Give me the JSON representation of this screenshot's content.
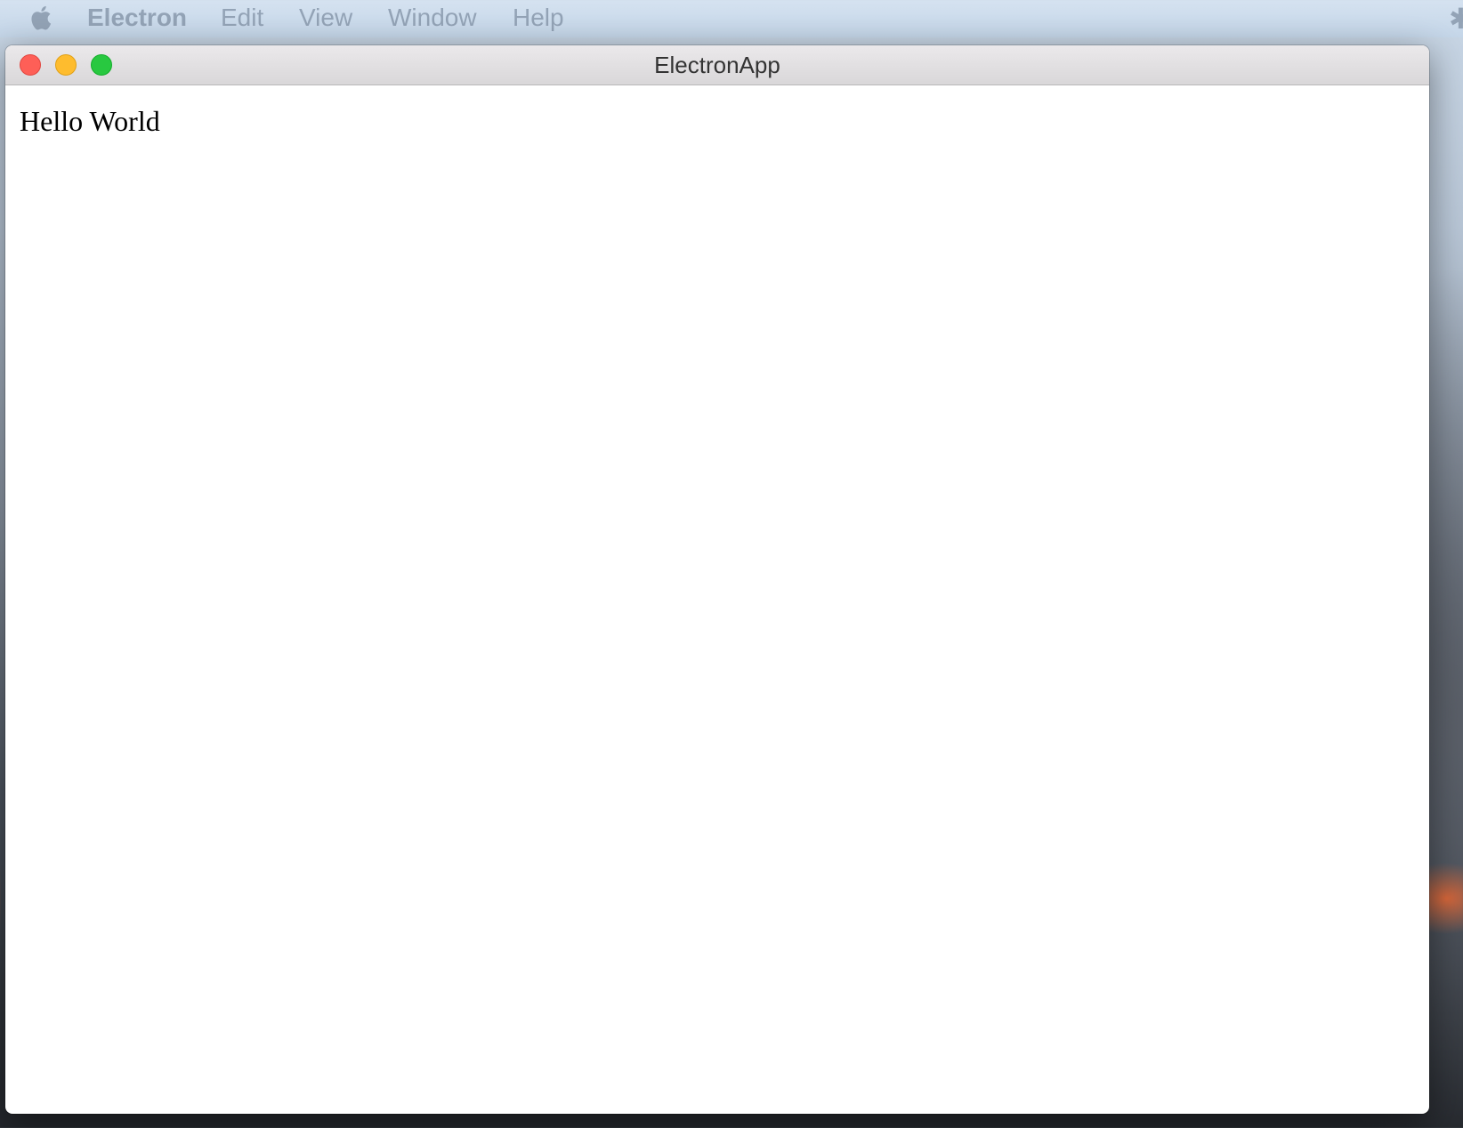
{
  "menubar": {
    "apple_icon": "apple-logo-icon",
    "items": [
      {
        "label": "Electron"
      },
      {
        "label": "Edit"
      },
      {
        "label": "View"
      },
      {
        "label": "Window"
      },
      {
        "label": "Help"
      }
    ],
    "status_icon": "bluetooth-icon"
  },
  "window": {
    "title": "ElectronApp",
    "controls": [
      "close",
      "minimize",
      "zoom"
    ]
  },
  "content": {
    "text": "Hello World"
  },
  "colors": {
    "close": "#fe5f57",
    "minimize": "#febc2e",
    "zoom": "#28c840",
    "menu_text": "#93a3b6"
  }
}
